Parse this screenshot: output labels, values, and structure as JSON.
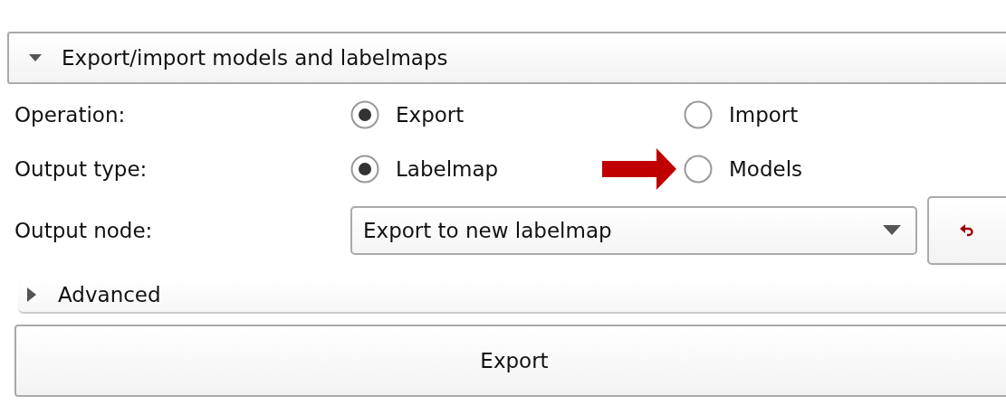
{
  "section": {
    "title": "Export/import models and labelmaps",
    "expanded": true
  },
  "options": [
    {
      "label": "Operation:",
      "choices": [
        {
          "label": "Export",
          "selected": true
        },
        {
          "label": "Import",
          "selected": false
        }
      ]
    },
    {
      "label": "Output type:",
      "choices": [
        {
          "label": "Labelmap",
          "selected": true
        },
        {
          "label": "Models",
          "selected": false
        }
      ]
    }
  ],
  "output_node": {
    "label": "Output node:",
    "value": "Export to new labelmap"
  },
  "advanced": {
    "title": "Advanced",
    "expanded": false
  },
  "export_button": "Export"
}
